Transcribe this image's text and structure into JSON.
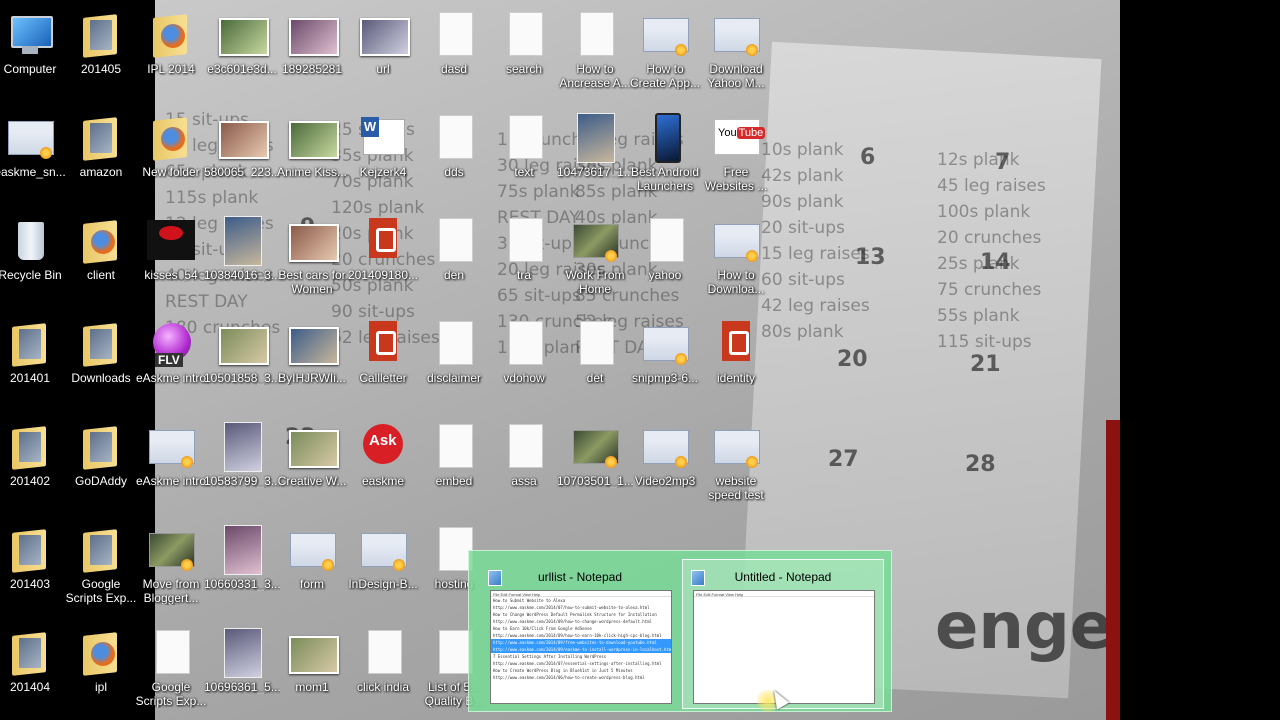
{
  "desktop": {
    "wallpaper_text": {
      "lines": [
        "15 sit-ups",
        "25 sit-ups",
        "10 crunches",
        "10 leg raises",
        "10s plank",
        "12s plank",
        "50 leg raises",
        "35s plank",
        "30 leg raises",
        "38s plank",
        "42s plank",
        "45 leg raises",
        "65s plank",
        "70s plank",
        "75s plank",
        "85s plank",
        "90s plank",
        "100s plank",
        "115s plank",
        "120s plank",
        "REST DAY",
        "40s plank",
        "20 sit-ups",
        "20 crunches",
        "12 leg raises",
        "20s plank",
        "35 sit-ups",
        "15 crunches",
        "15 leg raises",
        "25s plank",
        "40 sit-ups",
        "20 crunches",
        "20 leg raises",
        "30s plank",
        "60 sit-ups",
        "75 crunches",
        "40 leg raises",
        "50s plank",
        "65 sit-ups",
        "85 crunches",
        "42 leg raises",
        "55s plank",
        "REST DAY",
        "90 sit-ups",
        "130 crunches",
        "52 leg raises",
        "80s plank",
        "115 sit-ups",
        "180 crunches",
        "62 leg raises",
        "110s plank",
        "REST DAY",
        "enge"
      ],
      "numbers": [
        "6",
        "7",
        "13",
        "14",
        "20",
        "21",
        "27",
        "28",
        "9",
        "23"
      ]
    },
    "icons": [
      {
        "name": "computer",
        "label": "Computer",
        "glyph": "computer-icon"
      },
      {
        "name": "201405",
        "label": "201405",
        "glyph": "folder-icon"
      },
      {
        "name": "ipl-2014",
        "label": "IPL 2014",
        "glyph": "firefox-folder-icon"
      },
      {
        "name": "e3c601e3d",
        "label": "e3c601e3d...",
        "glyph": "photo-icon"
      },
      {
        "name": "189285281",
        "label": "189285281",
        "glyph": "photo-icon"
      },
      {
        "name": "url",
        "label": "url",
        "glyph": "photo-icon"
      },
      {
        "name": "dasd",
        "label": "dasd",
        "glyph": "text-file-icon"
      },
      {
        "name": "search",
        "label": "search",
        "glyph": "text-file-icon"
      },
      {
        "name": "how-to-ancrease",
        "label": "How to Ancrease A...",
        "glyph": "text-file-icon"
      },
      {
        "name": "how-to-create-app",
        "label": "How to Create App...",
        "glyph": "screenshot-icon"
      },
      {
        "name": "download-yahoo",
        "label": "Download Yahoo M...",
        "glyph": "screenshot-icon"
      },
      {
        "name": "easkme-sn",
        "label": "easkme_sn...",
        "glyph": "screenshot-icon"
      },
      {
        "name": "amazon",
        "label": "amazon",
        "glyph": "folder-icon"
      },
      {
        "name": "new-folder",
        "label": "New folder",
        "glyph": "firefox-folder-icon"
      },
      {
        "name": "580065",
        "label": "580065_223...",
        "glyph": "photo-icon"
      },
      {
        "name": "anime-kiss",
        "label": "Anime Kiss...",
        "glyph": "photo-icon"
      },
      {
        "name": "kejzerk4",
        "label": "Kejzerk4",
        "glyph": "word-icon"
      },
      {
        "name": "dds",
        "label": "dds",
        "glyph": "text-file-icon"
      },
      {
        "name": "text",
        "label": "text",
        "glyph": "text-file-icon"
      },
      {
        "name": "10473617",
        "label": "10473617_1...",
        "glyph": "tall-photo-icon"
      },
      {
        "name": "best-android-launchers",
        "label": "Best Android Launchers",
        "glyph": "phone-icon"
      },
      {
        "name": "free-websites",
        "label": "Free Websites ...",
        "glyph": "youtube-icon"
      },
      {
        "name": "recycle-bin",
        "label": "Recycle Bin",
        "glyph": "recycle-bin-icon"
      },
      {
        "name": "client",
        "label": "client",
        "glyph": "firefox-folder-icon"
      },
      {
        "name": "kisses-54",
        "label": "kisses_54",
        "glyph": "kiss-icon"
      },
      {
        "name": "10384016",
        "label": "10384016_3...",
        "glyph": "tall-photo-icon"
      },
      {
        "name": "best-cars-for-women",
        "label": "Best cars for Women",
        "glyph": "photo-icon"
      },
      {
        "name": "20140918",
        "label": "201409180...",
        "glyph": "pdf-icon"
      },
      {
        "name": "den",
        "label": "den",
        "glyph": "text-file-icon"
      },
      {
        "name": "tra",
        "label": "tra",
        "glyph": "text-file-icon"
      },
      {
        "name": "work-from-home",
        "label": "Work From Home",
        "glyph": "video-icon"
      },
      {
        "name": "yahoo",
        "label": "yahoo",
        "glyph": "text-file-icon"
      },
      {
        "name": "how-to-download",
        "label": "How to Downloa...",
        "glyph": "screenshot-icon"
      },
      {
        "name": "201401",
        "label": "201401",
        "glyph": "folder-icon"
      },
      {
        "name": "downloads",
        "label": "Downloads",
        "glyph": "folder-icon"
      },
      {
        "name": "easkme-intro-flv",
        "label": "eAskme intro",
        "glyph": "flv-icon"
      },
      {
        "name": "10501858",
        "label": "10501858_3...",
        "glyph": "photo-icon"
      },
      {
        "name": "byihjrwi",
        "label": "ByIHJRWIi...",
        "glyph": "photo-icon"
      },
      {
        "name": "callletter",
        "label": "Callletter",
        "glyph": "pdf-icon"
      },
      {
        "name": "disclaimer",
        "label": "disclaimer",
        "glyph": "text-file-icon"
      },
      {
        "name": "vdohow",
        "label": "vdohow",
        "glyph": "text-file-icon"
      },
      {
        "name": "det",
        "label": "det",
        "glyph": "text-file-icon"
      },
      {
        "name": "snipmp3",
        "label": "snipmp3-6...",
        "glyph": "screenshot-icon"
      },
      {
        "name": "identity",
        "label": "identity",
        "glyph": "pdf-icon"
      },
      {
        "name": "201402",
        "label": "201402",
        "glyph": "folder-icon"
      },
      {
        "name": "godaddy",
        "label": "GoDAddy",
        "glyph": "folder-icon"
      },
      {
        "name": "easkme-intro",
        "label": "eAskme intro",
        "glyph": "screenshot-icon"
      },
      {
        "name": "10583799",
        "label": "10583799_3...",
        "glyph": "tall-photo-icon"
      },
      {
        "name": "creative-w",
        "label": "Creative W...",
        "glyph": "photo-icon"
      },
      {
        "name": "easkme",
        "label": "easkme",
        "glyph": "ask-icon"
      },
      {
        "name": "embed",
        "label": "embed",
        "glyph": "text-file-icon"
      },
      {
        "name": "assa",
        "label": "assa",
        "glyph": "text-file-icon"
      },
      {
        "name": "10703501",
        "label": "10703501_1...",
        "glyph": "video-icon"
      },
      {
        "name": "video2mp3",
        "label": "Video2mp3",
        "glyph": "screenshot-icon"
      },
      {
        "name": "website-speed-test",
        "label": "website speed test",
        "glyph": "screenshot-icon"
      },
      {
        "name": "201403",
        "label": "201403",
        "glyph": "folder-icon"
      },
      {
        "name": "google-scripts-exp",
        "label": "Google Scripts Exp...",
        "glyph": "folder-icon"
      },
      {
        "name": "move-from-blogger",
        "label": "Move from Bloggert...",
        "glyph": "video-icon"
      },
      {
        "name": "10660331",
        "label": "10660331_3...",
        "glyph": "tall-photo-icon"
      },
      {
        "name": "form",
        "label": "form",
        "glyph": "screenshot-icon"
      },
      {
        "name": "indesign-b",
        "label": "InDesign-B...",
        "glyph": "screenshot-icon"
      },
      {
        "name": "hosting",
        "label": "hosting",
        "glyph": "text-file-icon"
      },
      {
        "name": "201404",
        "label": "201404",
        "glyph": "folder-icon"
      },
      {
        "name": "ipl",
        "label": "ipl",
        "glyph": "firefox-folder-icon"
      },
      {
        "name": "google-scripts-exp-2",
        "label": "Google Scripts Exp...",
        "glyph": "text-file-icon"
      },
      {
        "name": "10696361",
        "label": "10696361_5...",
        "glyph": "tall-photo-icon"
      },
      {
        "name": "mom1",
        "label": "mom1",
        "glyph": "photo-icon"
      },
      {
        "name": "click-india",
        "label": "click india",
        "glyph": "text-file-icon"
      },
      {
        "name": "list-of-quality",
        "label": "List of 5... Quality B...",
        "glyph": "text-file-icon"
      }
    ]
  },
  "preview_popup": {
    "windows": [
      {
        "title": "urllist - Notepad",
        "menu": "File  Edit  Format  View  Help",
        "lines": [
          {
            "text": "How to Submit Website to Alexa",
            "selected": false
          },
          {
            "text": "http://www.easkme.com/2014/07/how-to-submit-website-to-alexa.html",
            "selected": false
          },
          {
            "text": "How to Change WordPress Default Permalink Structure for Installation",
            "selected": false
          },
          {
            "text": "http://www.easkme.com/2014/09/how-to-change-wordpress-default.html",
            "selected": false
          },
          {
            "text": "How to Earn 10k/Click From Google AdSense",
            "selected": false
          },
          {
            "text": "http://www.easkme.com/2014/09/how-to-earn-10k-click-high-cpc-blog.html",
            "selected": false
          },
          {
            "text": "http://www.easkme.com/2014/09/free-websites-to-download-youtube.html",
            "selected": true
          },
          {
            "text": "http://www.easkme.com/2014/09/easkme-to-install-wordpress-in-localhost.html",
            "selected": true
          },
          {
            "text": "7 Essential Settings After Installing WordPress",
            "selected": false
          },
          {
            "text": "http://www.easkme.com/2014/07/essential-settings-after-installing.html",
            "selected": false
          },
          {
            "text": "How to Create WordPress Blog in Blueh1st in Just 5 Minutes",
            "selected": false
          },
          {
            "text": "http://www.easkme.com/2014/06/how-to-create-wordpress-blog.html",
            "selected": false
          }
        ]
      },
      {
        "title": "Untitled - Notepad",
        "menu": "File  Edit  Format  View  Help",
        "lines": []
      }
    ]
  }
}
